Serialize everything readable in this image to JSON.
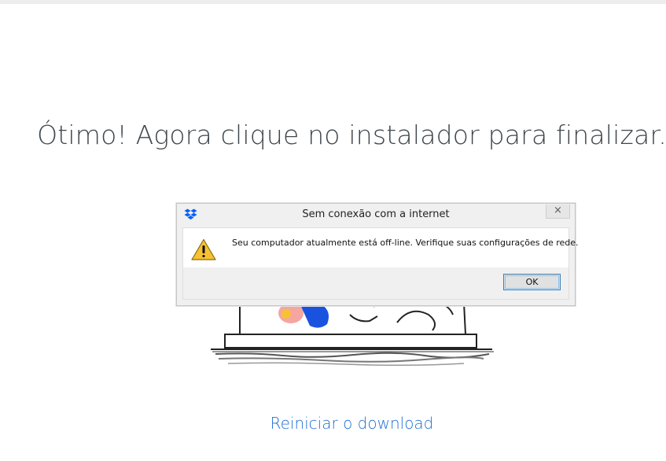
{
  "headline": "Ótimo! Agora clique no instalador para finalizar.",
  "dialog": {
    "app_icon": "dropbox-icon",
    "title": "Sem conexão com a internet",
    "close_label": "×",
    "warning_icon": "warning-triangle-icon",
    "message": "Seu computador atualmente está off-line. Verifique suas configurações de rede.",
    "ok_label": "OK"
  },
  "restart_link": "Reiniciar o download",
  "colors": {
    "link": "#1f6fd1",
    "headline": "#3d464d",
    "dropbox_blue": "#0061fe",
    "warning_yellow": "#f6c233"
  }
}
